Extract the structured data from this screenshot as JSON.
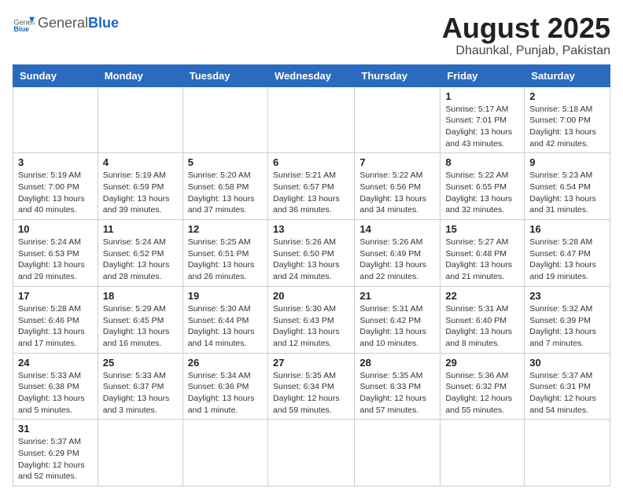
{
  "header": {
    "logo_general": "General",
    "logo_blue": "Blue",
    "month_year": "August 2025",
    "location": "Dhaunkal, Punjab, Pakistan"
  },
  "weekdays": [
    "Sunday",
    "Monday",
    "Tuesday",
    "Wednesday",
    "Thursday",
    "Friday",
    "Saturday"
  ],
  "weeks": [
    [
      {
        "day": "",
        "info": ""
      },
      {
        "day": "",
        "info": ""
      },
      {
        "day": "",
        "info": ""
      },
      {
        "day": "",
        "info": ""
      },
      {
        "day": "",
        "info": ""
      },
      {
        "day": "1",
        "info": "Sunrise: 5:17 AM\nSunset: 7:01 PM\nDaylight: 13 hours\nand 43 minutes."
      },
      {
        "day": "2",
        "info": "Sunrise: 5:18 AM\nSunset: 7:00 PM\nDaylight: 13 hours\nand 42 minutes."
      }
    ],
    [
      {
        "day": "3",
        "info": "Sunrise: 5:19 AM\nSunset: 7:00 PM\nDaylight: 13 hours\nand 40 minutes."
      },
      {
        "day": "4",
        "info": "Sunrise: 5:19 AM\nSunset: 6:59 PM\nDaylight: 13 hours\nand 39 minutes."
      },
      {
        "day": "5",
        "info": "Sunrise: 5:20 AM\nSunset: 6:58 PM\nDaylight: 13 hours\nand 37 minutes."
      },
      {
        "day": "6",
        "info": "Sunrise: 5:21 AM\nSunset: 6:57 PM\nDaylight: 13 hours\nand 36 minutes."
      },
      {
        "day": "7",
        "info": "Sunrise: 5:22 AM\nSunset: 6:56 PM\nDaylight: 13 hours\nand 34 minutes."
      },
      {
        "day": "8",
        "info": "Sunrise: 5:22 AM\nSunset: 6:55 PM\nDaylight: 13 hours\nand 32 minutes."
      },
      {
        "day": "9",
        "info": "Sunrise: 5:23 AM\nSunset: 6:54 PM\nDaylight: 13 hours\nand 31 minutes."
      }
    ],
    [
      {
        "day": "10",
        "info": "Sunrise: 5:24 AM\nSunset: 6:53 PM\nDaylight: 13 hours\nand 29 minutes."
      },
      {
        "day": "11",
        "info": "Sunrise: 5:24 AM\nSunset: 6:52 PM\nDaylight: 13 hours\nand 28 minutes."
      },
      {
        "day": "12",
        "info": "Sunrise: 5:25 AM\nSunset: 6:51 PM\nDaylight: 13 hours\nand 26 minutes."
      },
      {
        "day": "13",
        "info": "Sunrise: 5:26 AM\nSunset: 6:50 PM\nDaylight: 13 hours\nand 24 minutes."
      },
      {
        "day": "14",
        "info": "Sunrise: 5:26 AM\nSunset: 6:49 PM\nDaylight: 13 hours\nand 22 minutes."
      },
      {
        "day": "15",
        "info": "Sunrise: 5:27 AM\nSunset: 6:48 PM\nDaylight: 13 hours\nand 21 minutes."
      },
      {
        "day": "16",
        "info": "Sunrise: 5:28 AM\nSunset: 6:47 PM\nDaylight: 13 hours\nand 19 minutes."
      }
    ],
    [
      {
        "day": "17",
        "info": "Sunrise: 5:28 AM\nSunset: 6:46 PM\nDaylight: 13 hours\nand 17 minutes."
      },
      {
        "day": "18",
        "info": "Sunrise: 5:29 AM\nSunset: 6:45 PM\nDaylight: 13 hours\nand 16 minutes."
      },
      {
        "day": "19",
        "info": "Sunrise: 5:30 AM\nSunset: 6:44 PM\nDaylight: 13 hours\nand 14 minutes."
      },
      {
        "day": "20",
        "info": "Sunrise: 5:30 AM\nSunset: 6:43 PM\nDaylight: 13 hours\nand 12 minutes."
      },
      {
        "day": "21",
        "info": "Sunrise: 5:31 AM\nSunset: 6:42 PM\nDaylight: 13 hours\nand 10 minutes."
      },
      {
        "day": "22",
        "info": "Sunrise: 5:31 AM\nSunset: 6:40 PM\nDaylight: 13 hours\nand 8 minutes."
      },
      {
        "day": "23",
        "info": "Sunrise: 5:32 AM\nSunset: 6:39 PM\nDaylight: 13 hours\nand 7 minutes."
      }
    ],
    [
      {
        "day": "24",
        "info": "Sunrise: 5:33 AM\nSunset: 6:38 PM\nDaylight: 13 hours\nand 5 minutes."
      },
      {
        "day": "25",
        "info": "Sunrise: 5:33 AM\nSunset: 6:37 PM\nDaylight: 13 hours\nand 3 minutes."
      },
      {
        "day": "26",
        "info": "Sunrise: 5:34 AM\nSunset: 6:36 PM\nDaylight: 13 hours\nand 1 minute."
      },
      {
        "day": "27",
        "info": "Sunrise: 5:35 AM\nSunset: 6:34 PM\nDaylight: 12 hours\nand 59 minutes."
      },
      {
        "day": "28",
        "info": "Sunrise: 5:35 AM\nSunset: 6:33 PM\nDaylight: 12 hours\nand 57 minutes."
      },
      {
        "day": "29",
        "info": "Sunrise: 5:36 AM\nSunset: 6:32 PM\nDaylight: 12 hours\nand 55 minutes."
      },
      {
        "day": "30",
        "info": "Sunrise: 5:37 AM\nSunset: 6:31 PM\nDaylight: 12 hours\nand 54 minutes."
      }
    ],
    [
      {
        "day": "31",
        "info": "Sunrise: 5:37 AM\nSunset: 6:29 PM\nDaylight: 12 hours\nand 52 minutes."
      },
      {
        "day": "",
        "info": ""
      },
      {
        "day": "",
        "info": ""
      },
      {
        "day": "",
        "info": ""
      },
      {
        "day": "",
        "info": ""
      },
      {
        "day": "",
        "info": ""
      },
      {
        "day": "",
        "info": ""
      }
    ]
  ]
}
